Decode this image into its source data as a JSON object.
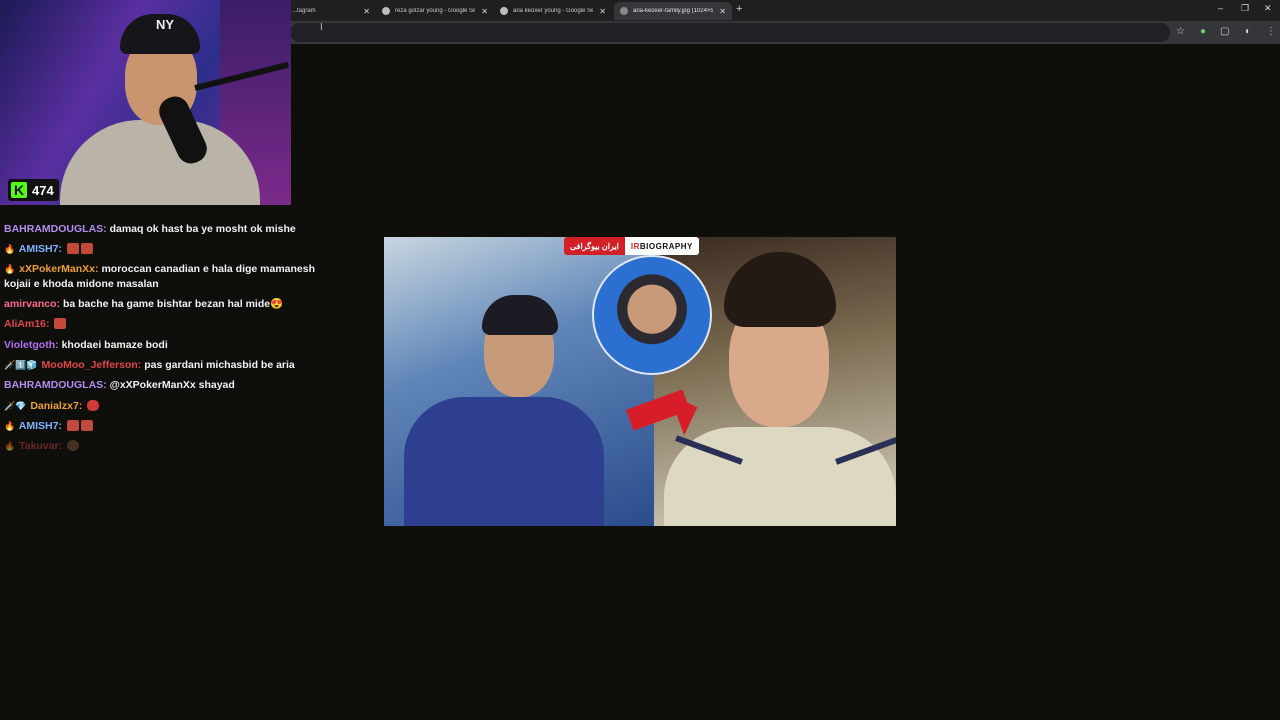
{
  "browser": {
    "tabs": [
      {
        "title": "...tagram",
        "active": false
      },
      {
        "title": "reza golzar young - Google Se...",
        "active": false
      },
      {
        "title": "aria keoxer young - Google Se...",
        "active": false
      },
      {
        "title": "aria-keoxer-family.jpg (1024×5...",
        "active": true
      }
    ],
    "new_tab_icon": "plus-icon",
    "window_controls": {
      "minimize": "–",
      "maximize": "❐",
      "close": "✕"
    },
    "toolbar_icons": [
      "star-icon",
      "extension-icon",
      "puzzle-icon",
      "profile-icon",
      "menu-icon"
    ]
  },
  "stream": {
    "platform_icon": "K",
    "viewer_count": "474"
  },
  "chat": {
    "messages": [
      {
        "badges": "🔥",
        "user": "BAHRAMDOUGLAS:",
        "user_color": "#b58cf0",
        "text": "damaq ok hast ba ye mosht ok mishe",
        "emotes": []
      },
      {
        "badges": "🔥",
        "user": "AMISH7:",
        "user_color": "#7fb3ff",
        "text": "",
        "emotes": [
          "red",
          "red"
        ]
      },
      {
        "badges": "🔥",
        "user": "xXPokerManXx:",
        "user_color": "#f0a030",
        "text": "moroccan canadian e hala dige mamanesh kojaii e khoda midone masalan",
        "emotes": []
      },
      {
        "badges": "",
        "user": "amirvanco:",
        "user_color": "#ff6a8a",
        "text": "ba bache ha game bishtar bezan hal mide😍",
        "emotes": []
      },
      {
        "badges": "",
        "user": "AliAm16:",
        "user_color": "#e0454a",
        "text": "",
        "emotes": [
          "red"
        ]
      },
      {
        "badges": "",
        "user": "Violetgoth:",
        "user_color": "#b070f0",
        "text": "khodaei bamaze bodi",
        "emotes": []
      },
      {
        "badges": "🗡️1️⃣🧊",
        "user": "MooMoo_Jefferson:",
        "user_color": "#e0454a",
        "text": "pas gardani michasbid be aria",
        "emotes": []
      },
      {
        "badges": "",
        "user": "BAHRAMDOUGLAS:",
        "user_color": "#b58cf0",
        "text": "@xXPokerManXx shayad",
        "emotes": []
      },
      {
        "badges": "🗡️💎",
        "user": "Danialzx7:",
        "user_color": "#f0a030",
        "text": "",
        "emotes": [
          "demon"
        ]
      },
      {
        "badges": "🔥",
        "user": "AMISH7:",
        "user_color": "#7fb3ff",
        "text": "",
        "emotes": [
          "red",
          "red"
        ]
      },
      {
        "badges": "🔥",
        "user": "Takuvar:",
        "user_color": "#e0454a",
        "text": "",
        "emotes": [
          "brown"
        ]
      }
    ]
  },
  "image": {
    "banner_fa": "ایران بیوگرافی",
    "banner_en_ir": "IR",
    "banner_en_rest": "BIOGRAPHY"
  }
}
